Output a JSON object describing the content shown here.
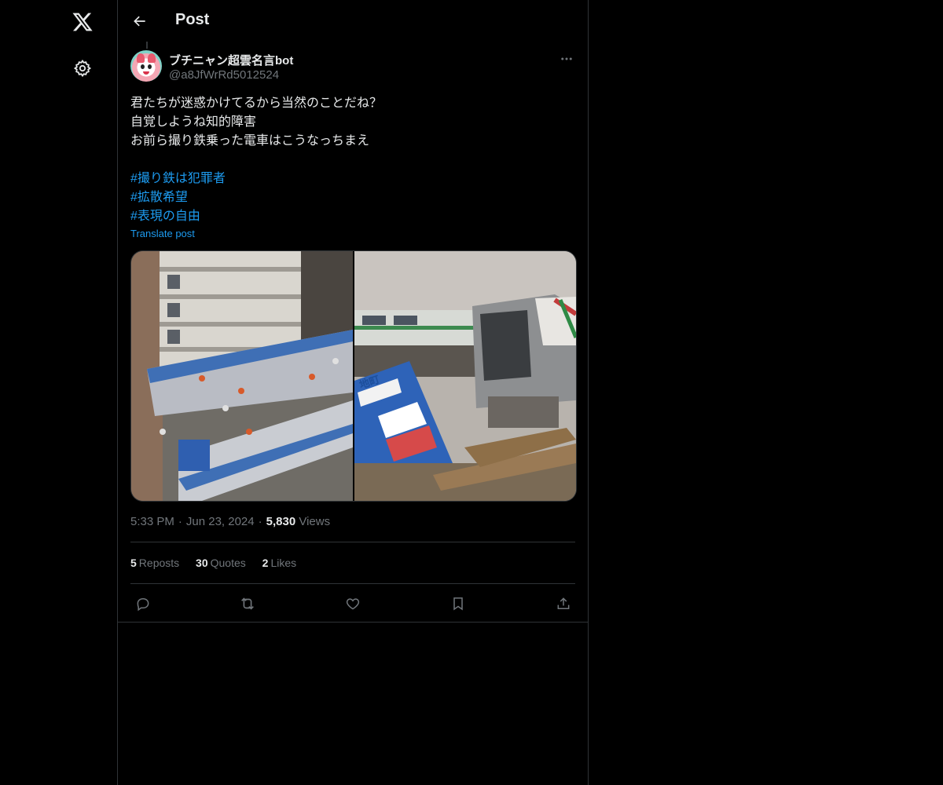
{
  "nav": {
    "logo_icon": "x-logo-icon",
    "settings_icon": "gear-icon"
  },
  "header": {
    "title": "Post",
    "back_icon": "arrow-left-icon"
  },
  "author": {
    "display_name": "ブチニャン超雲名言bot",
    "handle": "@a8JfWrRd5012524",
    "more_icon": "more-horizontal-icon"
  },
  "post": {
    "lines": [
      "君たちが迷惑かけてるから当然のことだね？",
      "自覚しようね知的障害",
      "お前ら撮り鉄乗った電車はこうなっちまえ"
    ],
    "hashtags": [
      "#撮り鉄は犯罪者",
      "#拡散希望",
      "#表現の自由"
    ],
    "translate_label": "Translate post",
    "media": [
      {
        "description_icon": "photo-icon"
      },
      {
        "description_icon": "photo-icon",
        "sign_text": "地町"
      }
    ],
    "time": "5:33 PM",
    "date": "Jun 23, 2024",
    "views_count": "5,830",
    "views_label": "Views"
  },
  "stats": {
    "reposts_count": "5",
    "reposts_label": "Reposts",
    "quotes_count": "30",
    "quotes_label": "Quotes",
    "likes_count": "2",
    "likes_label": "Likes"
  },
  "actions": {
    "reply_icon": "reply-icon",
    "repost_icon": "repost-icon",
    "like_icon": "heart-icon",
    "bookmark_icon": "bookmark-icon",
    "share_icon": "share-icon"
  },
  "colors": {
    "background": "#000000",
    "text": "#e7e9ea",
    "secondary": "#71767b",
    "accent": "#1d9bf0",
    "border": "#2f3336"
  }
}
